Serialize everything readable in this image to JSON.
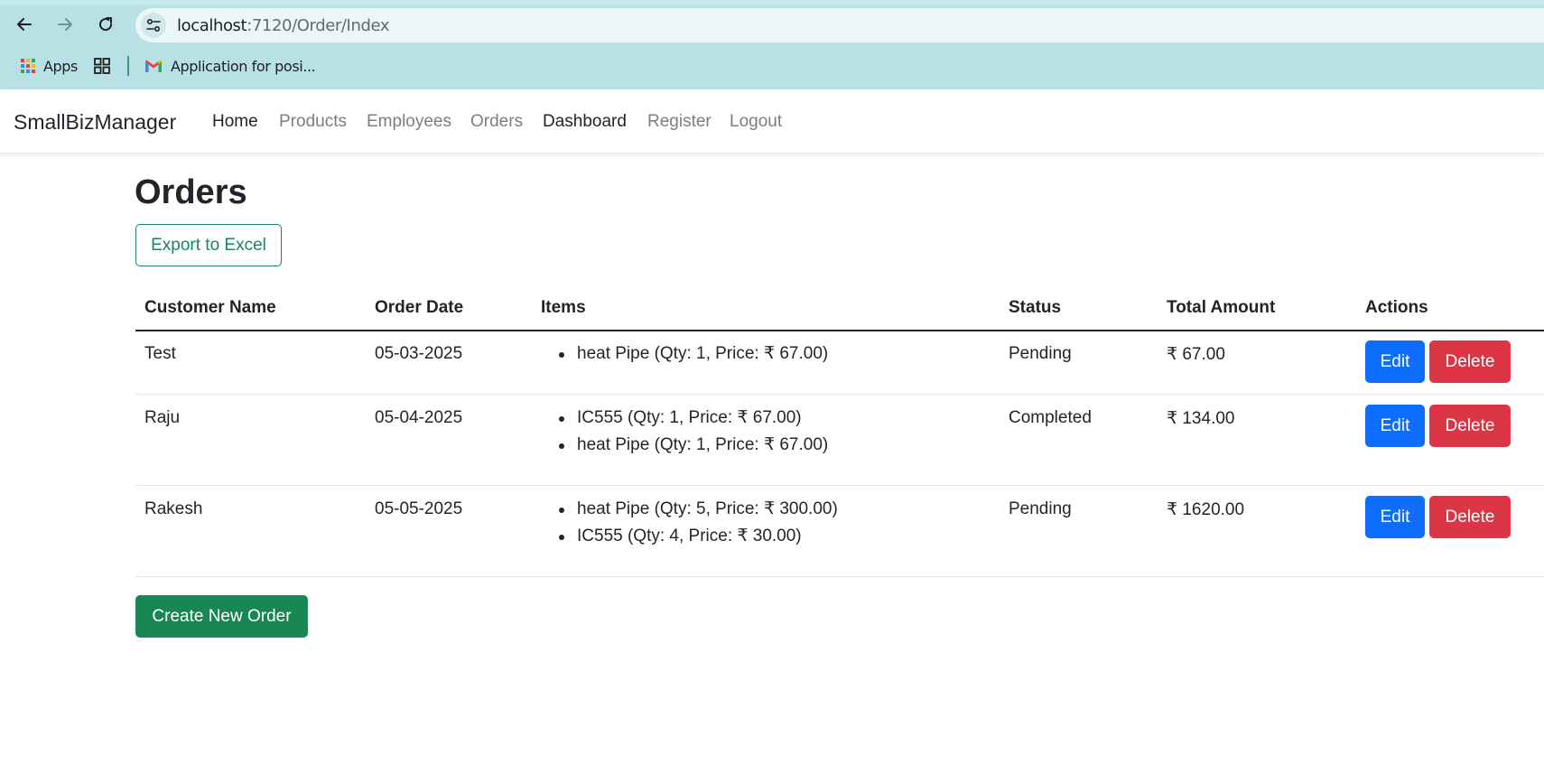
{
  "browser": {
    "url_host": "localhost",
    "url_path": ":7120/Order/Index",
    "bookmarks": [
      {
        "label": "Apps",
        "icon": "apps-grid-icon"
      },
      {
        "label": "",
        "icon": "tab-groups-icon"
      },
      {
        "label": "Application for posi...",
        "icon": "gmail-icon"
      }
    ]
  },
  "navbar": {
    "brand": "SmallBizManager",
    "links": [
      {
        "label": "Home",
        "style": "dark"
      },
      {
        "label": "Products",
        "style": "muted"
      },
      {
        "label": "Employees",
        "style": "muted"
      },
      {
        "label": "Orders",
        "style": "muted"
      },
      {
        "label": "Dashboard",
        "style": "dark"
      },
      {
        "label": "Register",
        "style": "muted"
      },
      {
        "label": "Logout",
        "style": "muted"
      }
    ]
  },
  "page": {
    "title": "Orders",
    "export_label": "Export to Excel",
    "create_label": "Create New Order"
  },
  "table": {
    "headers": [
      "Customer Name",
      "Order Date",
      "Items",
      "Status",
      "Total Amount",
      "Actions"
    ],
    "rows": [
      {
        "customer": "Test",
        "date": "05-03-2025",
        "items": [
          "heat Pipe (Qty: 1, Price: ₹ 67.00)"
        ],
        "status": "Pending",
        "total": "₹ 67.00",
        "edit_label": "Edit",
        "delete_label": "Delete"
      },
      {
        "customer": "Raju",
        "date": "05-04-2025",
        "items": [
          "IC555 (Qty: 1, Price: ₹ 67.00)",
          "heat Pipe (Qty: 1, Price: ₹ 67.00)"
        ],
        "status": "Completed",
        "total": "₹ 134.00",
        "edit_label": "Edit",
        "delete_label": "Delete"
      },
      {
        "customer": "Rakesh",
        "date": "05-05-2025",
        "items": [
          "heat Pipe (Qty: 5, Price: ₹ 300.00)",
          "IC555 (Qty: 4, Price: ₹ 30.00)"
        ],
        "status": "Pending",
        "total": "₹ 1620.00",
        "edit_label": "Edit",
        "delete_label": "Delete"
      }
    ]
  },
  "colors": {
    "chrome_bg": "#b8e1e5",
    "primary": "#0d6efd",
    "danger": "#dc3545",
    "success": "#198754"
  }
}
